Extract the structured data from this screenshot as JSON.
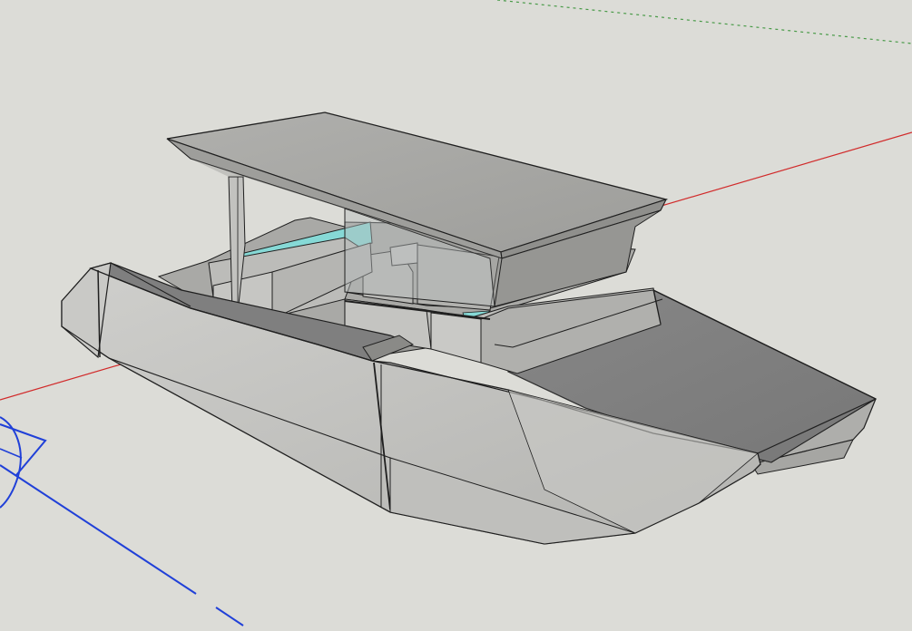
{
  "app": {
    "type": "3d-modeling-viewport"
  },
  "colors": {
    "background": "#dcdcd7",
    "red_axis": "#d12a2a",
    "green_axis": "#2f8f2f",
    "blue_axis": "#2040d8",
    "glass": "#86d9d6",
    "hull_light": "#c4c4c1",
    "hull_mid": "#b8b8b5",
    "hull_dark": "#9f9f9c",
    "roof_top": "#a7a7a4",
    "roof_side": "#8e8e8b",
    "deck": "#808080"
  },
  "scene": {
    "model": "boat",
    "tool_icon": "protractor-icon"
  }
}
